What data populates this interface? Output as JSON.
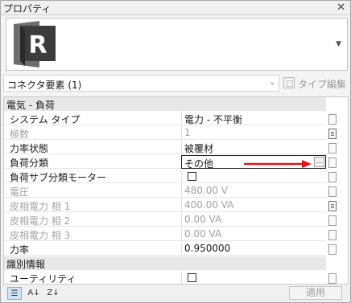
{
  "panel": {
    "title": "プロパティ",
    "close_glyph": "✕"
  },
  "type_selector": {
    "logo_letter": "R",
    "logo_icon": "revit-logo-icon"
  },
  "selection": {
    "label": "コネクタ要素 (1)",
    "edit_type_label": "タイプ編集"
  },
  "properties": {
    "group1": {
      "title": "電気 - 負荷"
    },
    "rows1": [
      {
        "name": "システム タイプ",
        "value": "電力 - 不平衡",
        "enabled": true
      },
      {
        "name": "極数",
        "value": "1",
        "enabled": false
      },
      {
        "name": "力率状態",
        "value": "被覆材",
        "enabled": true
      },
      {
        "name": "負荷分類",
        "value": "その他",
        "enabled": true,
        "selected": true
      },
      {
        "name": "負荷サブ分類モーター",
        "value": "",
        "enabled": true,
        "checkbox": true
      },
      {
        "name": "電圧",
        "value": "480.00 V",
        "enabled": false
      },
      {
        "name": "皮相電力 相 1",
        "value": "400.00 VA",
        "enabled": false
      },
      {
        "name": "皮相電力 相 2",
        "value": "0.00 VA",
        "enabled": false
      },
      {
        "name": "皮相電力 相 3",
        "value": "0.00 VA",
        "enabled": false
      },
      {
        "name": "力率",
        "value": "0.950000",
        "enabled": true
      }
    ],
    "group2": {
      "title": "識別情報"
    },
    "rows2": [
      {
        "name": "ユーティリティ",
        "value": "",
        "enabled": true,
        "checkbox": true
      }
    ],
    "ellipsis_label": "...",
    "collapse_glyph": "⌃"
  },
  "footer": {
    "apply_label": "適用"
  },
  "colors": {
    "annotation_arrow": "#e0141a"
  }
}
